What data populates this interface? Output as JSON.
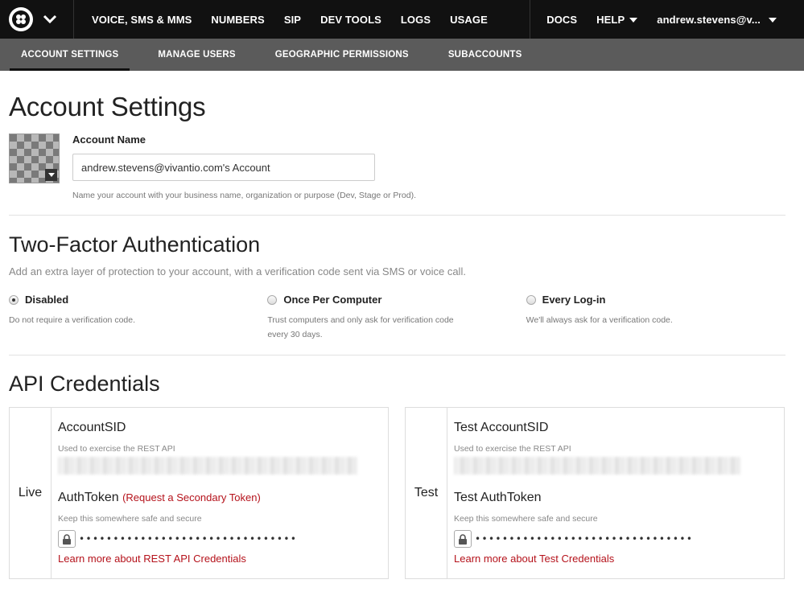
{
  "topnav": {
    "items": [
      "VOICE, SMS & MMS",
      "NUMBERS",
      "SIP",
      "DEV TOOLS",
      "LOGS",
      "USAGE"
    ],
    "docs": "DOCS",
    "help": "HELP",
    "user": "andrew.stevens@v..."
  },
  "subnav": {
    "items": [
      "ACCOUNT SETTINGS",
      "MANAGE USERS",
      "GEOGRAPHIC PERMISSIONS",
      "SUBACCOUNTS"
    ],
    "active_index": 0
  },
  "page": {
    "title": "Account Settings"
  },
  "account": {
    "label": "Account Name",
    "value": "andrew.stevens@vivantio.com's Account",
    "hint": "Name your account with your business name, organization or purpose (Dev, Stage or Prod)."
  },
  "twofa": {
    "title": "Two-Factor Authentication",
    "subtitle": "Add an extra layer of protection to your account, with a verification code sent via SMS or voice call.",
    "options": [
      {
        "label": "Disabled",
        "desc": "Do not require a verification code.",
        "selected": true
      },
      {
        "label": "Once Per Computer",
        "desc": "Trust computers and only ask for verification code every 30 days.",
        "selected": false
      },
      {
        "label": "Every Log-in",
        "desc": "We'll always ask for a verification code.",
        "selected": false
      }
    ]
  },
  "api": {
    "title": "API Credentials",
    "live": {
      "side": "Live",
      "sid_title": "AccountSID",
      "sid_hint": "Used to exercise the REST API",
      "token_title": "AuthToken",
      "token_link": "(Request a Secondary Token)",
      "token_hint": "Keep this somewhere safe and secure",
      "token_mask": "••••••••••••••••••••••••••••••••",
      "learn": "Learn more about REST API Credentials"
    },
    "test": {
      "side": "Test",
      "sid_title": "Test AccountSID",
      "sid_hint": "Used to exercise the REST API",
      "token_title": "Test AuthToken",
      "token_hint": "Keep this somewhere safe and secure",
      "token_mask": "••••••••••••••••••••••••••••••••",
      "learn": "Learn more about Test Credentials"
    }
  },
  "colors": {
    "topnav_bg": "#111111",
    "subnav_bg": "#5b5b5b",
    "link": "#b5121b"
  }
}
